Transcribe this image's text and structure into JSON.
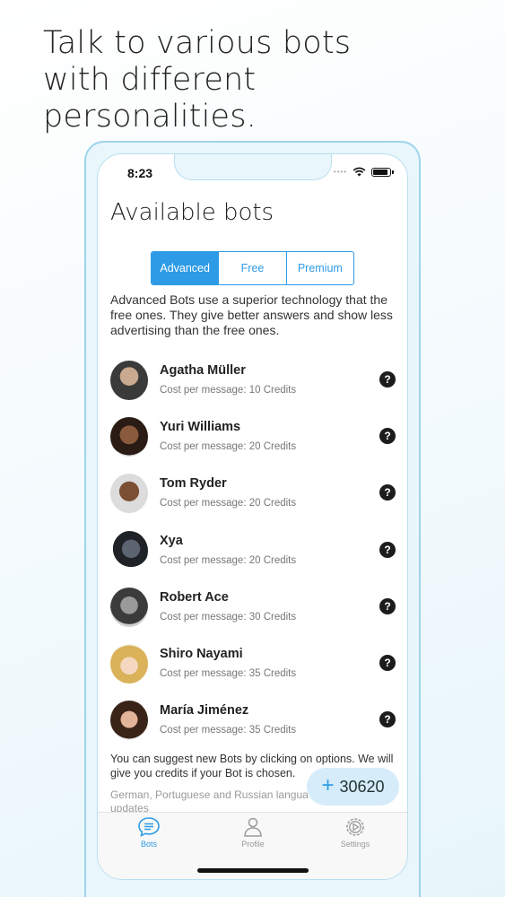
{
  "headline": "Talk to various bots\nwith different\npersonalities.",
  "status_bar": {
    "time": "8:23"
  },
  "page_title": "Available bots",
  "segments": [
    {
      "label": "Advanced",
      "active": true
    },
    {
      "label": "Free",
      "active": false
    },
    {
      "label": "Premium",
      "active": false
    }
  ],
  "description": "Advanced Bots use a superior technology that the free ones. They give better answers and show less advertising than the free ones.",
  "bots": [
    {
      "name": "Agatha Müller",
      "cost": "Cost per message: 10 Credits"
    },
    {
      "name": "Yuri Williams",
      "cost": "Cost per message: 20 Credits"
    },
    {
      "name": "Tom Ryder",
      "cost": "Cost per message: 20 Credits"
    },
    {
      "name": "Xya",
      "cost": "Cost per message: 20 Credits"
    },
    {
      "name": "Robert Ace",
      "cost": "Cost per message: 30 Credits"
    },
    {
      "name": "Shiro Nayami",
      "cost": "Cost per message: 35 Credits"
    },
    {
      "name": "María Jiménez",
      "cost": "Cost per message: 35 Credits"
    }
  ],
  "help_icon": "?",
  "suggest_text": "You can suggest new Bots by clicking on options. We will give you credits if your Bot is chosen.",
  "languages_text": "German, Portuguese and Russian langua updates",
  "credits": {
    "plus": "+",
    "amount": "30620"
  },
  "tabs": [
    {
      "label": "Bots",
      "icon": "chat-bubble-icon",
      "active": true
    },
    {
      "label": "Profile",
      "icon": "person-icon",
      "active": false
    },
    {
      "label": "Settings",
      "icon": "gear-icon",
      "active": false
    }
  ],
  "colors": {
    "accent": "#2e9be6",
    "fab_bg": "#d6ecfa",
    "frame": "#9fd4ec"
  }
}
